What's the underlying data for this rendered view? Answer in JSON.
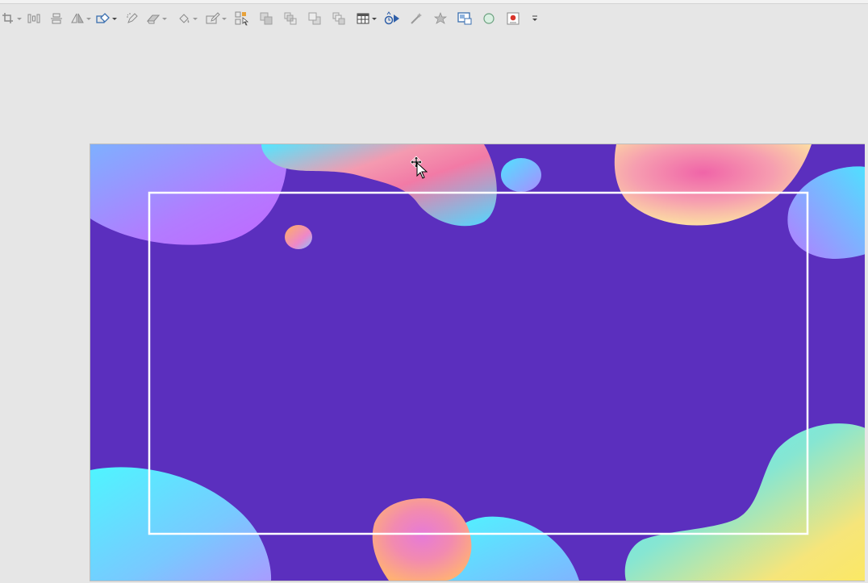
{
  "toolbar": {
    "items": [
      {
        "icon": "crop-icon",
        "dropdown": true
      },
      {
        "icon": "distribute-horizontal-icon",
        "dropdown": false
      },
      {
        "icon": "align-vertical-icon",
        "dropdown": false
      },
      {
        "icon": "flip-icon",
        "dropdown": true
      },
      {
        "icon": "shape-outline-icon",
        "dropdown": true,
        "active": true
      },
      {
        "icon": "pen-sparkle-icon",
        "dropdown": false
      },
      {
        "icon": "eraser-icon",
        "dropdown": true
      },
      {
        "icon": "fill-bucket-icon",
        "dropdown": true
      },
      {
        "icon": "pencil-outline-icon",
        "dropdown": true
      },
      {
        "icon": "select-objects-icon",
        "dropdown": false
      },
      {
        "icon": "bring-forward-icon",
        "dropdown": false
      },
      {
        "icon": "bring-to-front-icon",
        "dropdown": false
      },
      {
        "icon": "send-backward-icon",
        "dropdown": false
      },
      {
        "icon": "send-to-back-icon",
        "dropdown": false
      },
      {
        "icon": "table-icon",
        "dropdown": true
      },
      {
        "icon": "animation-icon",
        "dropdown": false
      },
      {
        "icon": "magic-wand-icon",
        "dropdown": false
      },
      {
        "icon": "effects-star-icon",
        "dropdown": false
      },
      {
        "icon": "slide-show-icon",
        "dropdown": false
      },
      {
        "icon": "circle-shape-icon",
        "dropdown": false
      },
      {
        "icon": "record-icon",
        "dropdown": false
      },
      {
        "icon": "toolbar-overflow-icon",
        "dropdown": false
      }
    ]
  },
  "slide": {
    "background_color": "#5b2fbe",
    "frame_color": "#ffffff"
  },
  "cursor": {
    "icon": "move-cursor-icon"
  }
}
